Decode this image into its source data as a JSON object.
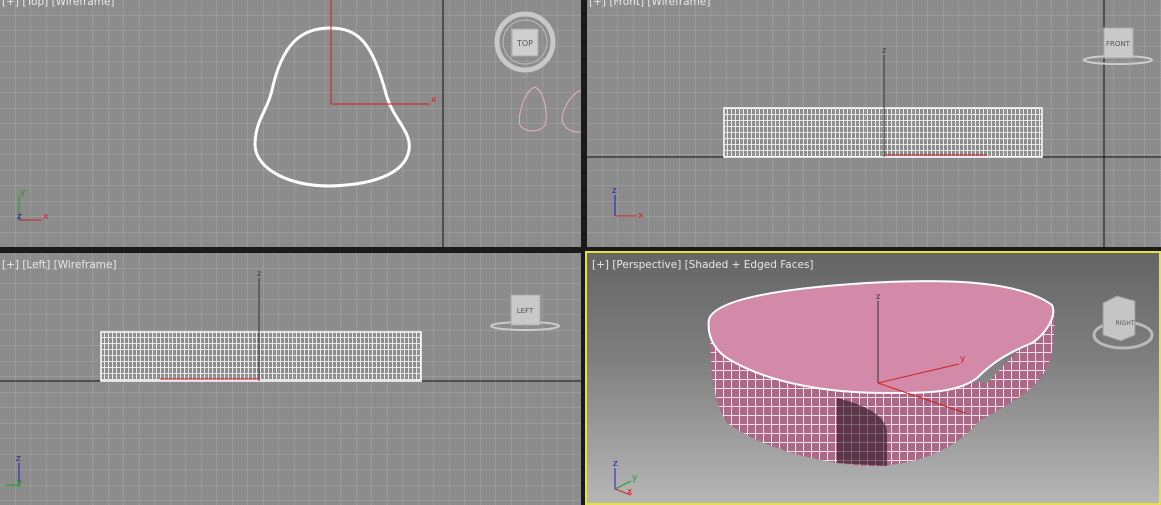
{
  "viewports": {
    "top": {
      "label": "[+] [Top] [Wireframe]",
      "viewcube": "TOP",
      "axes": {
        "x": "x",
        "y": "y",
        "z": "z"
      }
    },
    "front": {
      "label": "[+] [Front] [Wireframe]",
      "viewcube": "FRONT",
      "axes": {
        "x": "x",
        "z": "z"
      }
    },
    "left": {
      "label": "[+] [Left] [Wireframe]",
      "viewcube": "LEFT",
      "axes": {
        "y": "y",
        "z": "z"
      }
    },
    "perspective": {
      "label": "[+] [Perspective] [Shaded + Edged Faces]",
      "viewcube": "RIGHT",
      "axes": {
        "x": "x",
        "y": "y",
        "z": "z"
      }
    }
  },
  "colors": {
    "active_border": "#e8e040",
    "object_color": "#d68aaa",
    "grid": "#a6a6a6",
    "axis_x": "#d02020",
    "axis_y": "#20a020",
    "axis_z": "#2020c0"
  }
}
